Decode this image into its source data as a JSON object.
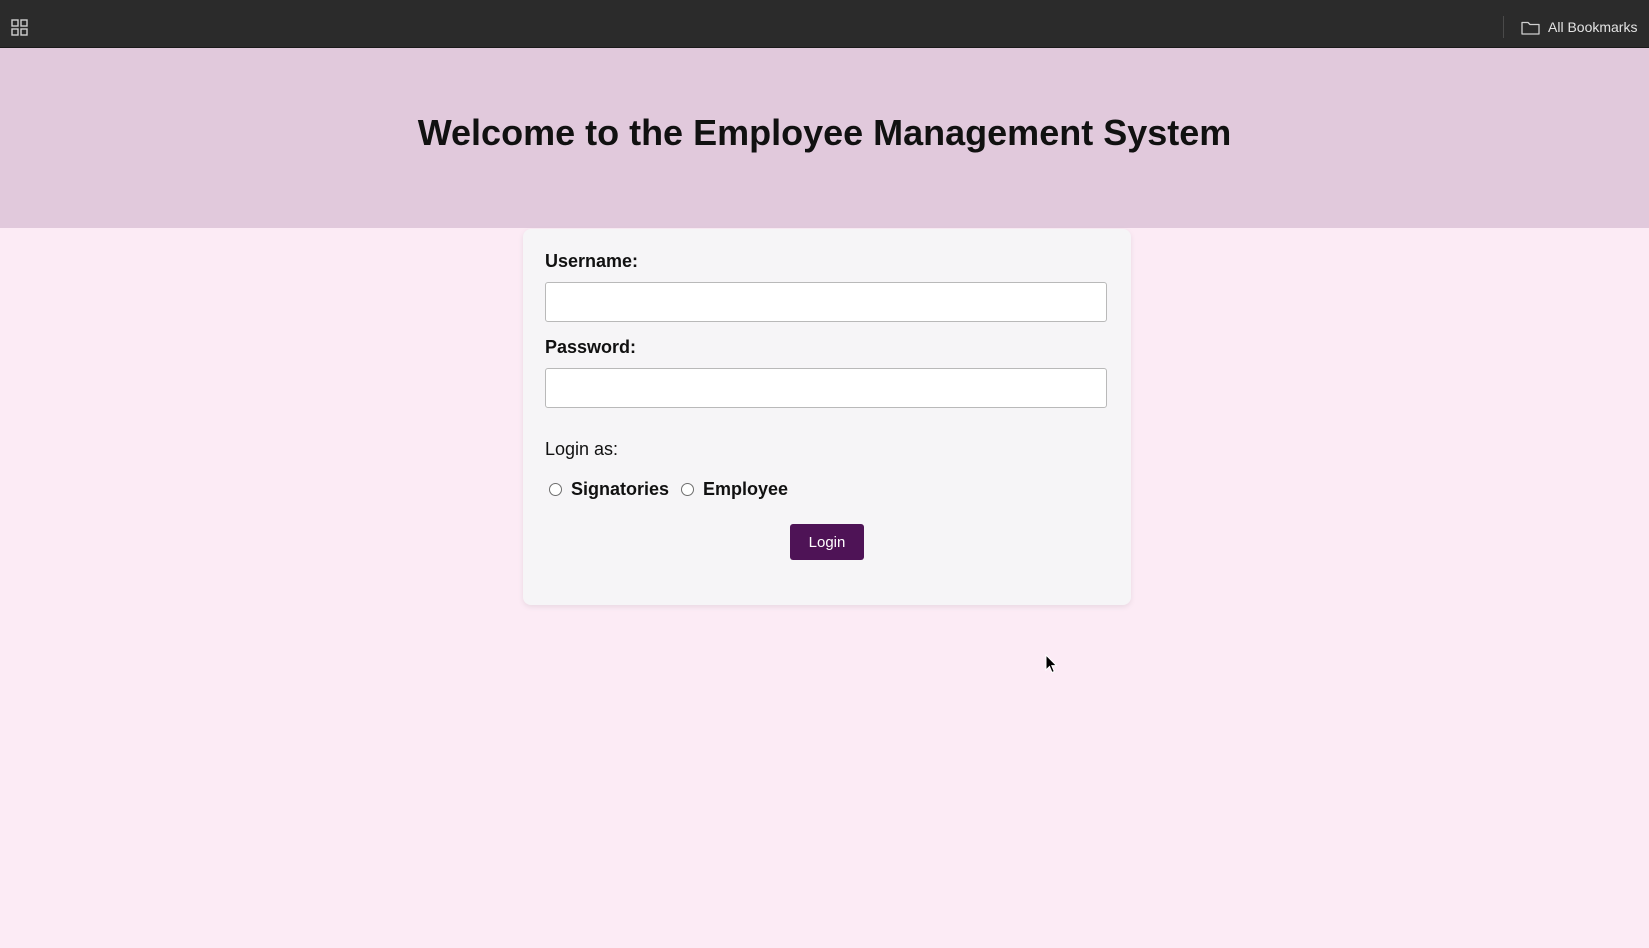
{
  "bookmarks_bar": {
    "apps_icon": "grid-icon",
    "all_bookmarks_label": "All Bookmarks",
    "folder_icon": "folder-icon"
  },
  "header": {
    "title": "Welcome to the Employee Management System",
    "background": "#e1c9dc"
  },
  "login_form": {
    "username_label": "Username:",
    "username_value": "",
    "password_label": "Password:",
    "password_value": "",
    "login_as_label": "Login as:",
    "roles": [
      "Signatories",
      "Employee"
    ],
    "selected_role": null,
    "submit_label": "Login",
    "button_color": "#4e1356"
  },
  "colors": {
    "page_background": "#fcebf5",
    "card_background": "#f6f5f7",
    "toolbar_background": "#2b2b2b"
  }
}
